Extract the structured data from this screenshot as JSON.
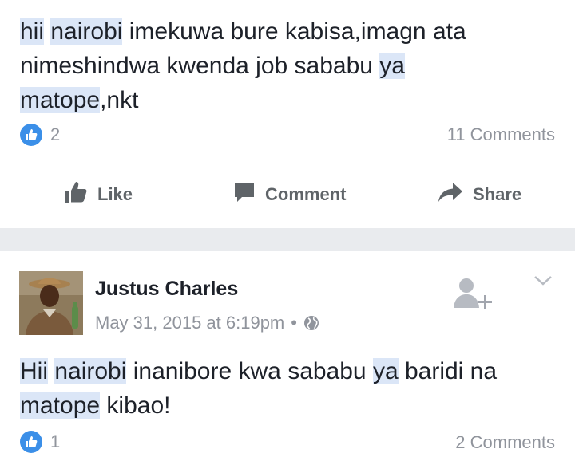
{
  "post1": {
    "text_parts": [
      "hii",
      " ",
      "nairobi",
      " imekuwa bure kabisa,imagn ata",
      "nimeshindwa kwenda job sababu ",
      "ya",
      "matope",
      ",nkt"
    ],
    "like_count": "2",
    "comment_count": "11 Comments"
  },
  "actions": {
    "like": "Like",
    "comment": "Comment",
    "share": "Share"
  },
  "post2": {
    "author": "Justus Charles",
    "timestamp": "May 31, 2015 at 6:19pm",
    "separator": "•",
    "privacy_icon": "globe-icon",
    "text_parts": [
      "Hii",
      " ",
      "nairobi",
      " inanibore kwa sababu ",
      "ya",
      " baridi na",
      "matope",
      " kibao!"
    ],
    "like_count": "1",
    "comment_count": "2 Comments"
  },
  "colors": {
    "accent": "#3b8fe8",
    "highlight": "#dbe6f7",
    "text": "#1d2129",
    "muted": "#90949c",
    "separator_band": "#e9ebee"
  }
}
